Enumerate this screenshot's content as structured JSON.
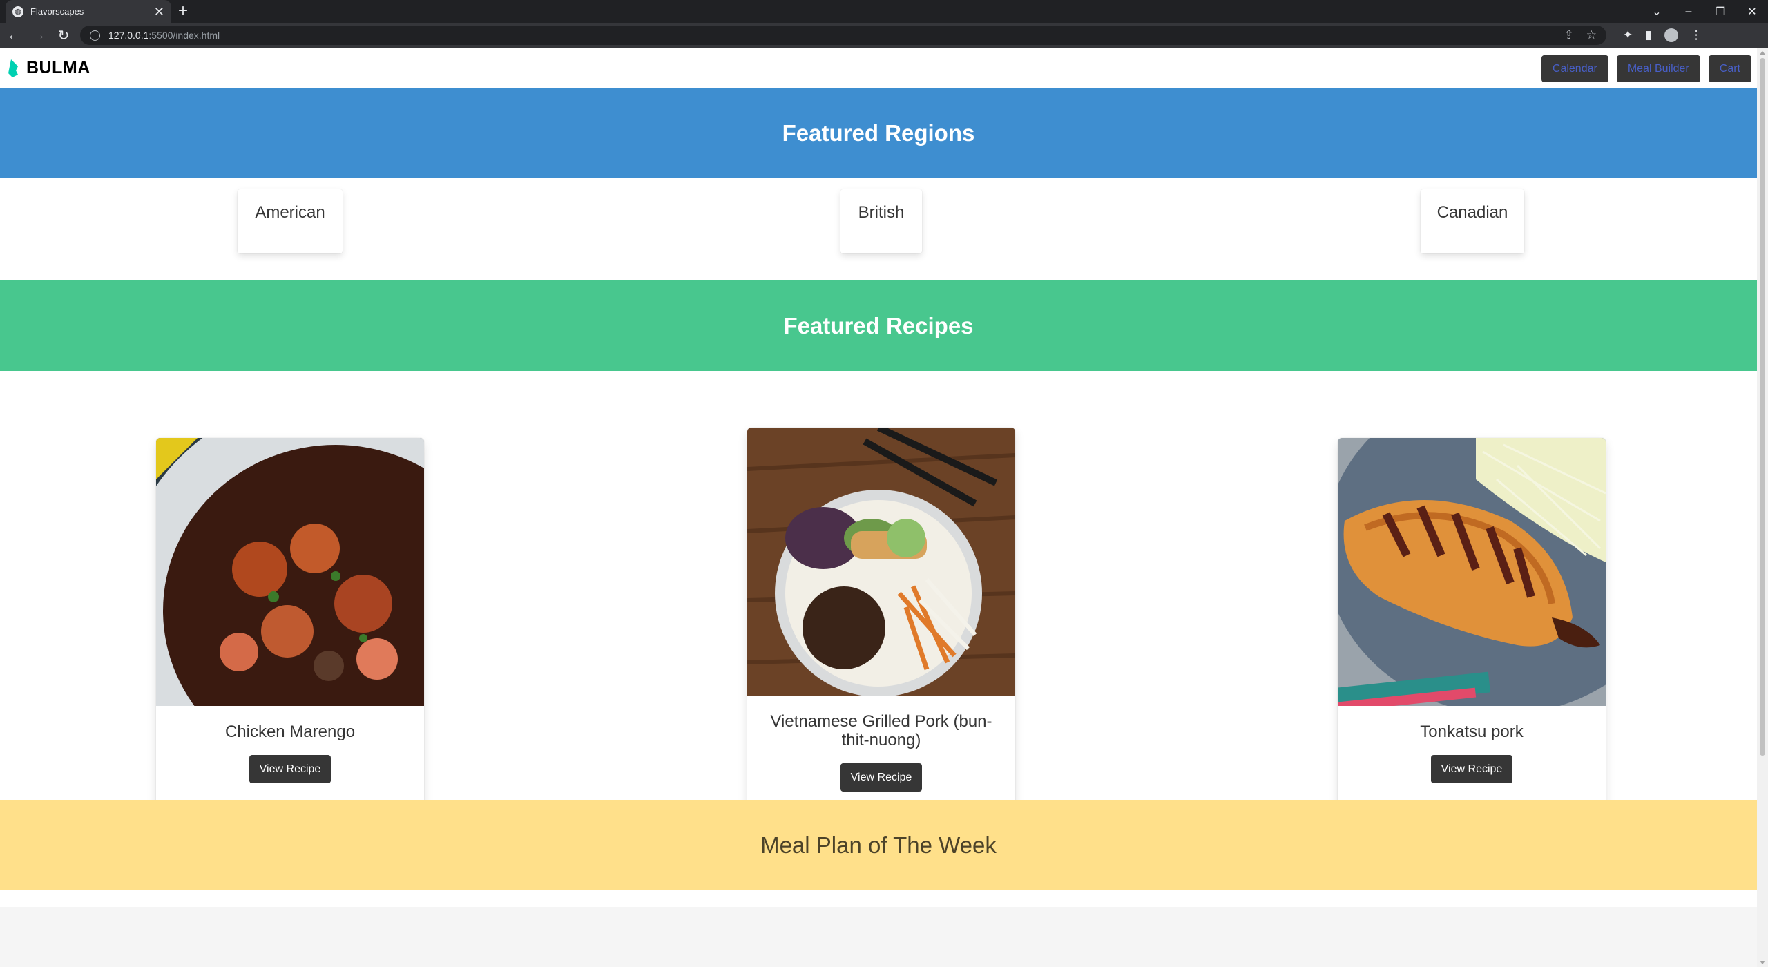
{
  "browser": {
    "tab_title": "Flavorscapes",
    "tab_close": "✕",
    "new_tab": "+",
    "url_host": "127.0.0.1",
    "url_rest": ":5500/index.html"
  },
  "navbar": {
    "brand": "BULMA",
    "buttons": [
      "Calendar",
      "Meal Builder",
      "Cart"
    ]
  },
  "regions": {
    "title": "Featured Regions",
    "items": [
      "American",
      "British",
      "Canadian"
    ]
  },
  "recipes": {
    "title": "Featured Recipes",
    "items": [
      {
        "name": "Chicken Marengo",
        "button": "View Recipe"
      },
      {
        "name": "Vietnamese Grilled Pork (bun-thit-nuong)",
        "button": "View Recipe"
      },
      {
        "name": "Tonkatsu pork",
        "button": "View Recipe"
      }
    ]
  },
  "meal_plan": {
    "title": "Meal Plan of The Week"
  },
  "colors": {
    "blue_hero": "#3e8ed0",
    "green_hero": "#48c78e",
    "yellow_hero": "#ffe08a",
    "dark_button": "#363636",
    "link_blue": "#485fc7"
  }
}
